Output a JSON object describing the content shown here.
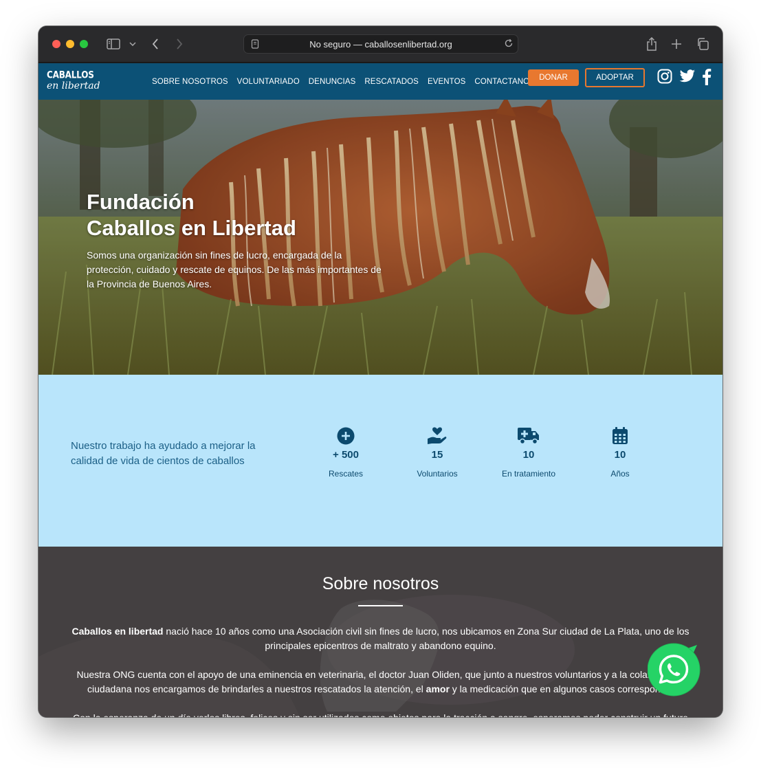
{
  "browser": {
    "url_text": "No seguro — caballosenlibertad.org"
  },
  "site": {
    "logo_line1": "CABALLOS",
    "logo_line2": "en libertad",
    "nav": [
      "SOBRE NOSOTROS",
      "VOLUNTARIADO",
      "DENUNCIAS",
      "RESCATADOS",
      "EVENTOS",
      "CONTACTANOS"
    ],
    "donar": "DONAR",
    "adoptar": "ADOPTAR"
  },
  "hero": {
    "title_line1": "Fundación",
    "title_line2": "Caballos en Libertad",
    "text": "Somos una organización sin fines de lucro, encargada de la protección, cuidado y rescate de equinos. De las más importantes de la Provincia de Buenos Aires."
  },
  "stats": {
    "lead": "Nuestro trabajo ha ayudado a mejorar la calidad de vida de cientos de caballos",
    "items": [
      {
        "icon": "plus-circle-icon",
        "value": "+ 500",
        "label": "Rescates"
      },
      {
        "icon": "hand-heart-icon",
        "value": "15",
        "label": "Voluntarios"
      },
      {
        "icon": "ambulance-icon",
        "value": "10",
        "label": "En tratamiento"
      },
      {
        "icon": "calendar-icon",
        "value": "10",
        "label": "Años"
      }
    ]
  },
  "about": {
    "title": "Sobre nosotros",
    "p1_bold": "Caballos en libertad",
    "p1_rest": " nació hace 10 años como una Asociación civil sin fines de lucro, nos ubicamos en Zona Sur ciudad de La Plata, uno de los principales epicentros de maltrato y abandono equino.",
    "p2_a": "Nuestra ONG cuenta con el apoyo de una eminencia en veterinaria, el doctor Juan Oliden, que junto a nuestros voluntarios y a la colaboración ciudadana nos encargamos de brindarles a nuestros rescatados la atención, el ",
    "p2_bold": "amor",
    "p2_b": " y la medicación que en algunos casos corresponde.",
    "p3": "Con la esperanza de un día verlos libres, felices y sin ser utilizados como objetos para la tracción a sangre, esperamos poder construir un futuro"
  },
  "colors": {
    "nav_bg": "#0c5176",
    "accent": "#e8782f",
    "stats_bg": "#b9e5fb",
    "stats_text": "#0c4a6e",
    "whatsapp": "#25d366"
  }
}
